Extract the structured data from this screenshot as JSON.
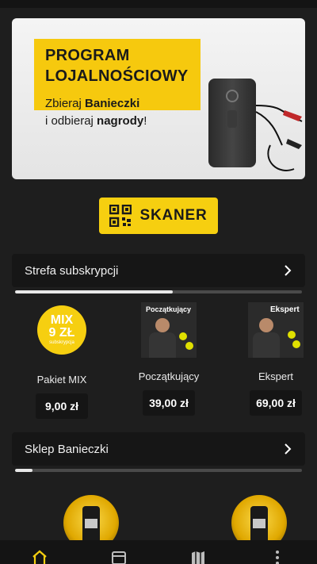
{
  "banner": {
    "title_line1": "PROGRAM",
    "title_line2": "LOJALNOŚCIOWY",
    "subtitle_pre": "Zbieraj ",
    "subtitle_bold1": "Banieczki",
    "subtitle_mid": "i odbieraj ",
    "subtitle_bold2": "nagrody",
    "subtitle_end": "!"
  },
  "scanner": {
    "label": "SKANER",
    "icon": "qr-code-icon"
  },
  "subscriptions": {
    "title": "Strefa subskrypcji",
    "progress": 0.55,
    "items": [
      {
        "name": "Pakiet MIX",
        "price": "9,00 zł",
        "badge_line1": "MIX",
        "badge_line2": "9 ZŁ",
        "badge_small": "subskrypcja"
      },
      {
        "name": "Początkujący",
        "price": "39,00 zł",
        "tag": "Początkujący"
      },
      {
        "name": "Ekspert",
        "price": "69,00 zł",
        "tag": "Ekspert"
      }
    ]
  },
  "shop": {
    "title": "Sklep Banieczki",
    "progress": 0.06
  },
  "colors": {
    "accent": "#f6cf10",
    "background": "#1e1e1e",
    "panel": "#161616"
  },
  "nav": [
    "home-icon",
    "wallet-icon",
    "map-icon",
    "more-vertical-icon"
  ]
}
